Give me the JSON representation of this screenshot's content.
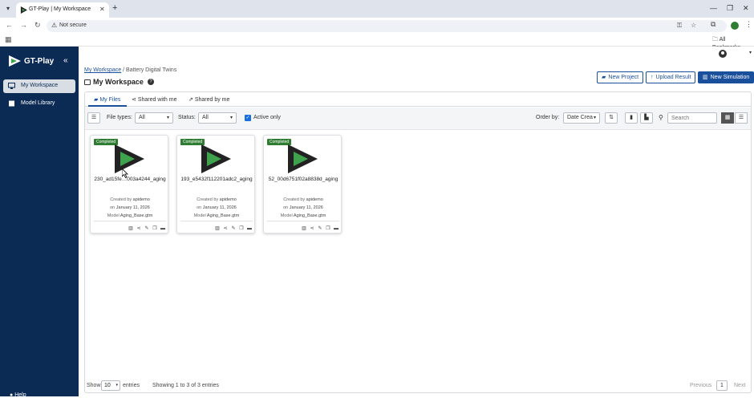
{
  "browser": {
    "tab_title": "GT-Play | My Workspace",
    "new_tab": "+",
    "security": "Not secure",
    "all_bookmarks": "All Bookmarks"
  },
  "sidebar": {
    "brand": "GT-Play",
    "collapse": "«",
    "items": [
      {
        "label": "My Workspace",
        "icon": "monitor-icon",
        "active": true
      },
      {
        "label": "Model Library",
        "icon": "library-icon",
        "active": false
      }
    ],
    "help": "Help"
  },
  "breadcrumb": {
    "root": "My Workspace",
    "separator": "/",
    "current": "Battery Digital Twins"
  },
  "page": {
    "title": "My Workspace",
    "help_mark": "?"
  },
  "actions": {
    "new_project": "New Project",
    "upload_result": "Upload Result",
    "new_simulation": "New Simulation"
  },
  "tabs": [
    {
      "label": "My Files",
      "active": true
    },
    {
      "label": "Shared with me",
      "active": false
    },
    {
      "label": "Shared by me",
      "active": false
    }
  ],
  "filters": {
    "file_types_label": "File types:",
    "file_types_value": "All",
    "status_label": "Status:",
    "status_value": "All",
    "active_only_label": "Active only",
    "active_only_checked": true,
    "order_by_label": "Order by:",
    "order_by_value": "Date Crea",
    "search_placeholder": "Search"
  },
  "cards": [
    {
      "status": "Completed",
      "name": "230_ad15fe…003a4244_aging",
      "created_by_label": "Created by",
      "created_by": "apidemo",
      "on_label": "on",
      "date": "January 11, 2026",
      "model_label": "Model",
      "model": "Aging_Base.gtm"
    },
    {
      "status": "Completed",
      "name": "193_e5432f112201adc2_aging",
      "created_by_label": "Created by",
      "created_by": "apidemo",
      "on_label": "on",
      "date": "January 11, 2026",
      "model_label": "Model",
      "model": "Aging_Base.gtm"
    },
    {
      "status": "Completed",
      "name": "52_00d6751f02a8838d_aging",
      "created_by_label": "Created by",
      "created_by": "apidemo",
      "on_label": "on",
      "date": "January 11, 2026",
      "model_label": "Model",
      "model": "Aging_Base.gtm"
    }
  ],
  "footer": {
    "show_label": "Show",
    "page_size": "10",
    "entries_label": "entries",
    "summary": "Showing 1 to 3 of 3 entries",
    "previous": "Previous",
    "current_page": "1",
    "next": "Next"
  },
  "colors": {
    "sidebar_bg": "#0b2b55",
    "primary": "#1a4f9c",
    "badge_green": "#2e7d32",
    "logo_green": "#3fa34d"
  }
}
